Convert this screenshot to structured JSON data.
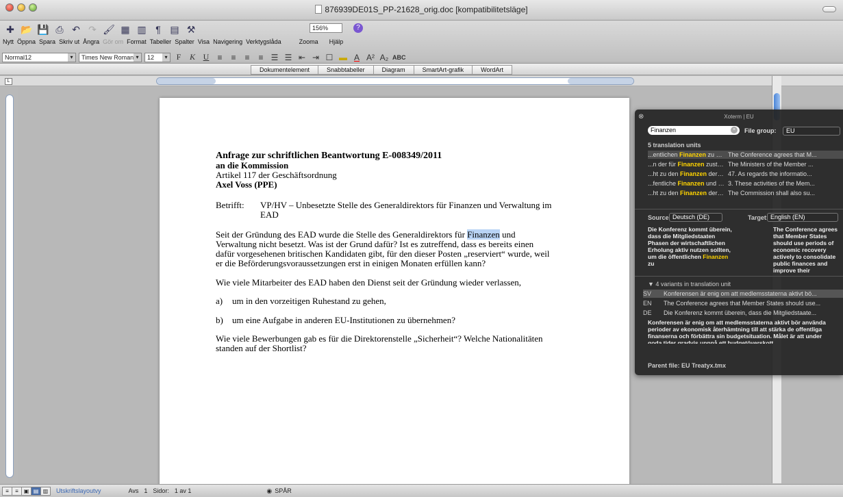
{
  "window": {
    "title": "876939DE01S_PP-21628_orig.doc [kompatibilitetsläge]"
  },
  "toolbar": {
    "labels": [
      "Nytt",
      "Öppna",
      "Spara",
      "Skriv ut",
      "Ångra",
      "Gör om",
      "Format",
      "Tabeller",
      "Spalter",
      "Visa",
      "Navigering",
      "Verktygslåda",
      "Zooma",
      "Hjälp"
    ],
    "zoom": "156%"
  },
  "format": {
    "style": "Normal12",
    "font": "Times New Roman",
    "size": "12"
  },
  "ribbon": {
    "tabs": [
      "Dokumentelement",
      "Snabbtabeller",
      "Diagram",
      "SmartArt-grafik",
      "WordArt"
    ]
  },
  "document": {
    "heading1": "Anfrage zur schriftlichen Beantwortung E-008349/2011",
    "heading2": "an die Kommission",
    "article": "Artikel 117 der Geschäftsordnung",
    "author": "Axel Voss (PPE)",
    "subject_label": "Betrifft:",
    "subject_line1": "VP/HV – Unbesetzte Stelle des Generaldirektors für Finanzen und Verwaltung im",
    "subject_line2": "EAD",
    "p1_a": "Seit der Gründung des EAD wurde die Stelle des Generaldirektors für ",
    "p1_hl": "Finanzen",
    "p1_b": " und",
    "p1_l2": "Verwaltung nicht besetzt. Was ist der Grund dafür? Ist es zutreffend, dass es bereits einen",
    "p1_l3": "dafür vorgesehenen britischen Kandidaten gibt, für den dieser Posten „reserviert“ wurde, weil",
    "p1_l4": "er die Beförderungsvoraussetzungen erst in einigen Monaten erfüllen kann?",
    "p2": "Wie viele Mitarbeiter des EAD haben den Dienst seit der Gründung wieder verlassen,",
    "a_label": "a)",
    "a_text": "um in den vorzeitigen Ruhestand zu gehen,",
    "b_label": "b)",
    "b_text": "um eine Aufgabe in anderen EU-Institutionen zu übernehmen?",
    "p3_l1": "Wie viele Bewerbungen gab es für die Direktorenstelle „Sicherheit“? Welche Nationalitäten",
    "p3_l2": "standen auf der Shortlist?"
  },
  "status": {
    "view": "Utskriftslayoutvy",
    "avs_label": "Avs",
    "avs": "1",
    "pages_label": "Sidor:",
    "pages": "1 av 1",
    "track": "SPÅR"
  },
  "xoterm": {
    "title": "Xoterm | EU",
    "search": "Finanzen",
    "file_group_label": "File group:",
    "file_group": "EU",
    "count": "5 translation units",
    "units": [
      {
        "pre": "...entlichen ",
        "hit": "Finanzen",
        "post": " zu kons...",
        "target": "The Conference agrees that M..."
      },
      {
        "pre": "...n der für ",
        "hit": "Finanzen",
        "post": " zuständi...",
        "target": "The Ministers of the Member ..."
      },
      {
        "pre": "...ht zu den ",
        "hit": "Finanzen",
        "post": " der Eur...",
        "target": "47. As regards the informatio..."
      },
      {
        "pre": "...fentliche ",
        "hit": "Finanzen",
        "post": " und mon...",
        "target": "3. These activities of the Mem..."
      },
      {
        "pre": "...ht zu den ",
        "hit": "Finanzen",
        "post": " der Uni...",
        "target": "The Commission shall also su..."
      }
    ],
    "source_label": "Source:",
    "source_lang": "Deutsch (DE)",
    "target_label": "Target:",
    "target_lang": "English (EN)",
    "source_text": "Die Konferenz kommt überein, dass die Mitgliedstaaten Phasen der wirtschaftlichen Erholung aktiv nutzen sollten, um die öffentlichen",
    "source_hit": "Finanzen",
    "source_tail": " zu",
    "target_text": "The Conference agrees that Member States should use periods of economic recovery actively to consolidate public finances and improve their",
    "variants_label": "4 variants in translation unit",
    "variants": [
      {
        "code": "SV",
        "text": "Konferensen är enig om att medlemsstaterna aktivt bö..."
      },
      {
        "code": "EN",
        "text": "The Conference agrees that Member States should use..."
      },
      {
        "code": "DE",
        "text": "Die Konferenz kommt überein, dass die Mitgliedstaate..."
      }
    ],
    "variant_text": "Konferensen är enig om att medlemsstaterna aktivt bör använda perioder av ekonomisk återhämtning till att stärka de offentliga finanserna och förbättra sin budgetsituation. Målet är att under goda tider gradvis uppnå ett budgetöverskott",
    "parent_file": "Parent file: EU Treatyx.tmx"
  }
}
